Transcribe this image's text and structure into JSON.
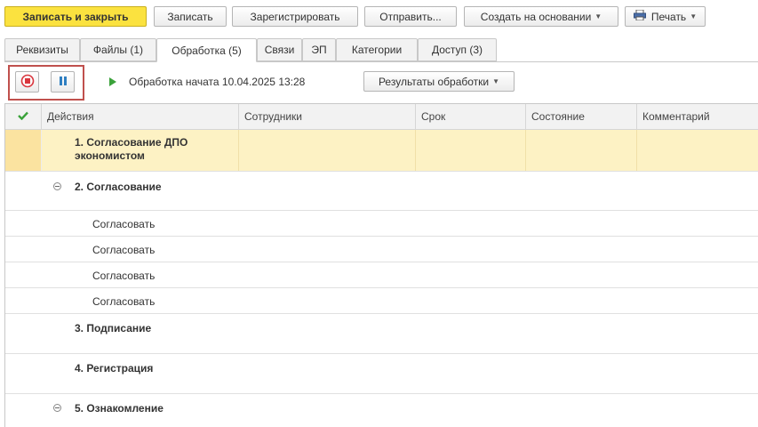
{
  "toolbar": {
    "save_close": "Записать и закрыть",
    "save": "Записать",
    "register": "Зарегистрировать",
    "send": "Отправить...",
    "create_based": "Создать на основании",
    "print": "Печать"
  },
  "tabs": [
    {
      "label": "Реквизиты"
    },
    {
      "label": "Файлы (1)"
    },
    {
      "label": "Обработка (5)"
    },
    {
      "label": "Связи"
    },
    {
      "label": "ЭП"
    },
    {
      "label": "Категории"
    },
    {
      "label": "Доступ (3)"
    }
  ],
  "active_tab": "Обработка (5)",
  "process": {
    "status_text": "Обработка начата 10.04.2025 13:28",
    "results_button": "Результаты обработки"
  },
  "table": {
    "columns": [
      "Действия",
      "Сотрудники",
      "Срок",
      "Состояние",
      "Комментарий"
    ],
    "rows": [
      {
        "line1": "1. Согласование ДПО",
        "line2": "экономистом",
        "bold": true,
        "selected": true
      },
      {
        "line1": "2. Согласование",
        "bold": true,
        "collapsible": true
      },
      {
        "line1": "Согласовать"
      },
      {
        "line1": "Согласовать"
      },
      {
        "line1": "Согласовать"
      },
      {
        "line1": "Согласовать"
      },
      {
        "line1": "3. Подписание",
        "bold": true
      },
      {
        "line1": "4. Регистрация",
        "bold": true
      },
      {
        "line1": "5. Ознакомление",
        "bold": true,
        "collapsible": true
      }
    ]
  },
  "colors": {
    "primary_button": "#fbe23f",
    "selected_row": "#fdf2c4",
    "highlight_border": "#c0504d",
    "stop_icon": "#d9363e",
    "pause_icon": "#2f7fc1",
    "play_icon": "#3aa23a",
    "check_icon": "#3aa23a"
  }
}
